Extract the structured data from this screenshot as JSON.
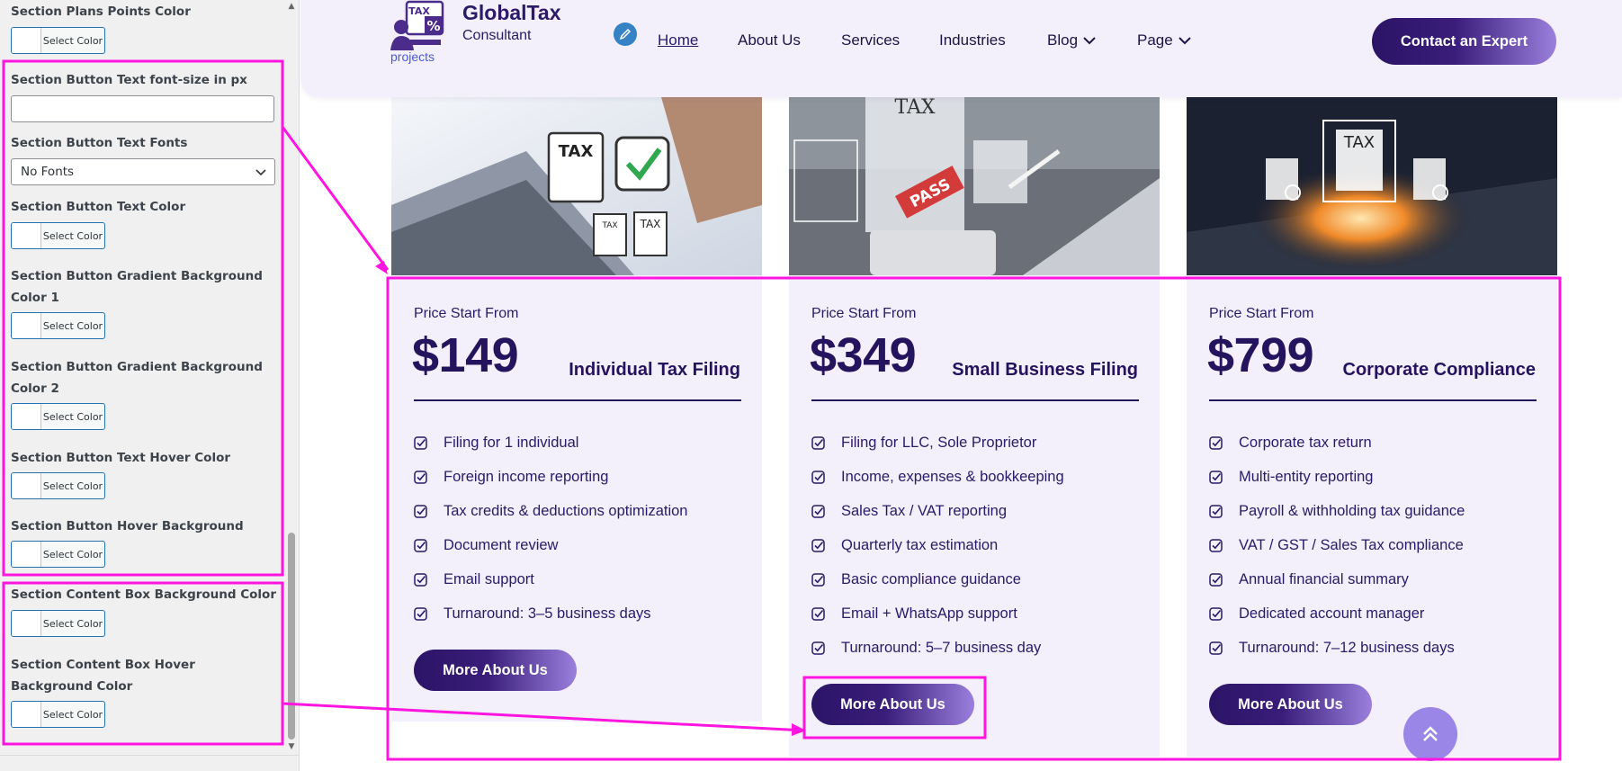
{
  "sidebar": {
    "labels": {
      "plans_points_color": "Section Plans Points Color",
      "btn_font_size": "Section Button Text font-size in px",
      "btn_fonts": "Section Button Text Fonts",
      "btn_text_color": "Section Button Text Color",
      "btn_grad1": "Section Button Gradient Background Color 1",
      "btn_grad2": "Section Button Gradient Background Color 2",
      "btn_hover_text": "Section Button Text Hover Color",
      "btn_hover_bg": "Section Button Hover Background Color",
      "content_bg": "Section Content Box Background Color",
      "content_hover_bg": "Section Content Box Hover Background Color"
    },
    "select_color_label": "Select Color",
    "font_size_value": "",
    "fonts_selected": "No Fonts"
  },
  "site": {
    "logo_badge": "TAX",
    "logo_percent": "%",
    "logo_title": "GlobalTax",
    "logo_subtitle": "Consultant",
    "logo_tagline": "projects",
    "nav": [
      "Home",
      "About Us",
      "Services",
      "Industries",
      "Blog",
      "Page"
    ],
    "cta": "Contact an Expert"
  },
  "cards": [
    {
      "price_from": "Price Start From",
      "price": "$149",
      "name": "Individual Tax Filing",
      "image_texts": [
        "TAX",
        "TAX",
        "TAX"
      ],
      "features": [
        "Filing for 1 individual",
        "Foreign income reporting",
        "Tax credits & deductions optimization",
        "Document review",
        "Email support",
        "Turnaround: 3–5 business days"
      ],
      "button": "More About Us"
    },
    {
      "price_from": "Price Start From",
      "price": "$349",
      "name": "Small Business Filing",
      "image_texts": [
        "TAX",
        "PASS"
      ],
      "features": [
        "Filing for LLC, Sole Proprietor",
        "Income, expenses & bookkeeping",
        "Sales Tax / VAT reporting",
        "Quarterly tax estimation",
        "Basic compliance guidance",
        "Email + WhatsApp support",
        "Turnaround: 5–7 business day"
      ],
      "button": "More About Us"
    },
    {
      "price_from": "Price Start From",
      "price": "$799",
      "name": "Corporate Compliance",
      "image_texts": [
        "TAX"
      ],
      "features": [
        "Corporate tax return",
        "Multi-entity reporting",
        "Payroll & withholding tax guidance",
        "VAT / GST / Sales Tax compliance",
        "Annual financial summary",
        "Dedicated account manager",
        "Turnaround: 7–12 business days"
      ],
      "button": "More About Us"
    }
  ],
  "colors": {
    "brand_dark": "#24145e",
    "gradient_start": "#2b1466",
    "gradient_end": "#9a7fdc",
    "card_bg": "#f3f0fb",
    "annotation": "#ff14e0"
  },
  "icons": [
    "pencil-icon",
    "chevron-down-icon",
    "checkbox-icon",
    "double-chevron-up-icon",
    "select-arrow-icon"
  ]
}
